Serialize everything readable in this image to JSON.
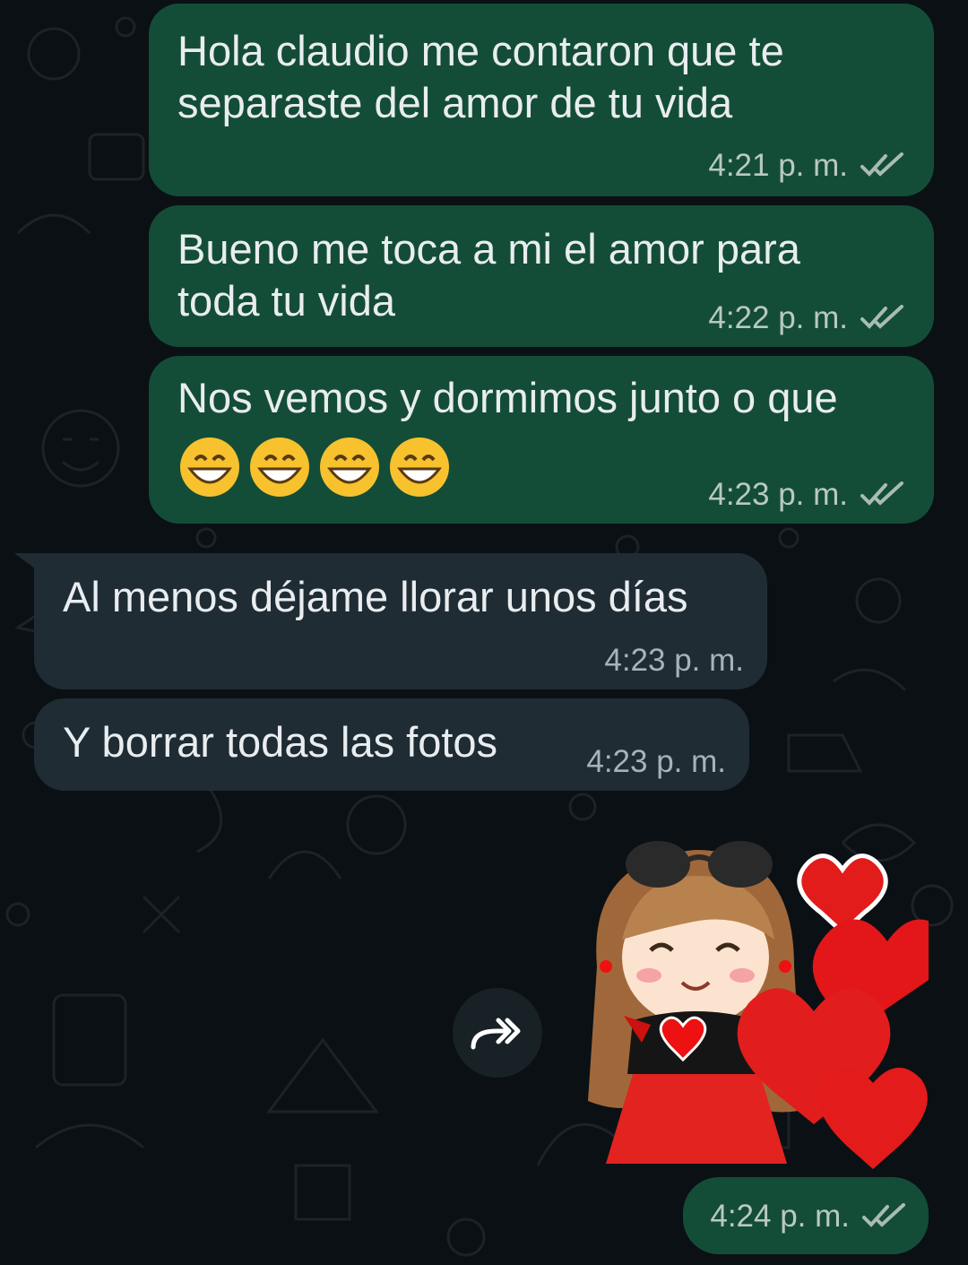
{
  "messages": [
    {
      "dir": "out",
      "text": "Hola claudio me contaron que te separaste del amor de tu vida",
      "time": "4:21 p. m.",
      "read": true
    },
    {
      "dir": "out",
      "text": "Bueno me toca a mi el amor para toda tu vida",
      "time": "4:22 p. m.",
      "read": true
    },
    {
      "dir": "out",
      "text": "Nos vemos y dormimos junto o que",
      "emoji": [
        "grinning-face-icon",
        "grinning-face-icon",
        "grinning-face-icon",
        "grinning-face-icon"
      ],
      "time": "4:23 p. m.",
      "read": true
    },
    {
      "dir": "in",
      "text": "Al menos déjame llorar unos días",
      "time": "4:23 p. m."
    },
    {
      "dir": "in",
      "text": "Y borrar todas las fotos",
      "time": "4:23 p. m."
    },
    {
      "dir": "out",
      "type": "sticker",
      "sticker": "girl-with-hearts-sticker",
      "time": "4:24 p. m.",
      "read": true
    }
  ],
  "colors": {
    "background": "#0b1014",
    "outgoing_bubble": "#144d37",
    "incoming_bubble": "#1f2c34",
    "read_ticks": "#a9bcb4"
  },
  "icons": {
    "forward": "forward-icon",
    "read_receipt": "double-check-icon"
  }
}
